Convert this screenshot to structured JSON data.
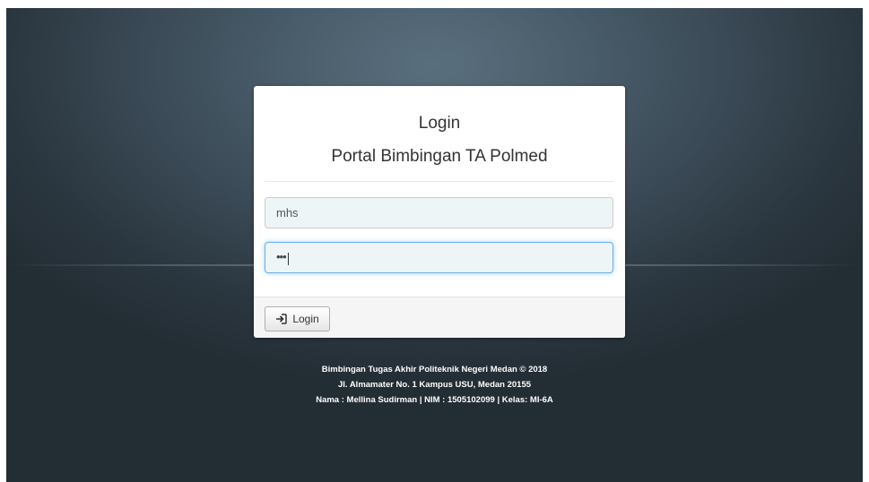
{
  "login_card": {
    "title": "Login",
    "subtitle": "Portal Bimbingan TA Polmed",
    "username_value": "mhs",
    "password_dots": "•••",
    "login_button_label": "Login"
  },
  "footer": {
    "line1": "Bimbingan Tugas Akhir Politeknik Negeri Medan © 2018",
    "line2": "Jl. Almamater No. 1 Kampus USU, Medan 20155",
    "line3": "Nama : Mellina Sudirman | NIM : 1505102099 | Kelas: MI-6A"
  },
  "icons": {
    "login_icon": "sign-in-icon"
  },
  "colors": {
    "background": "#3a4a56",
    "focus_border": "#66afe9",
    "input_fill": "#eef5f7"
  }
}
